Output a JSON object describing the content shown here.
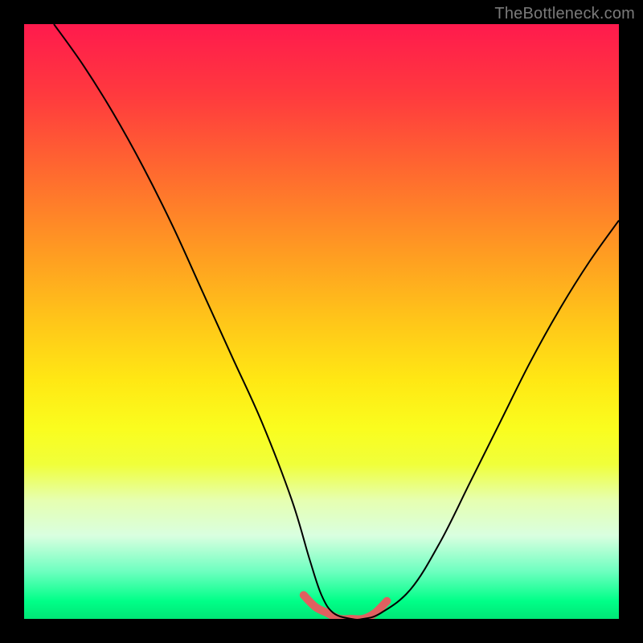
{
  "watermark": "TheBottleneck.com",
  "colors": {
    "background": "#000000",
    "curve": "#000000",
    "highlight": "#e06060"
  },
  "chart_data": {
    "type": "line",
    "title": "",
    "xlabel": "",
    "ylabel": "",
    "xlim": [
      0,
      100
    ],
    "ylim": [
      0,
      100
    ],
    "grid": false,
    "legend": false,
    "series": [
      {
        "name": "curve",
        "x": [
          5,
          10,
          15,
          20,
          25,
          30,
          35,
          40,
          45,
          48,
          50,
          52,
          55,
          57,
          60,
          65,
          70,
          75,
          80,
          85,
          90,
          95,
          100
        ],
        "y": [
          100,
          93,
          85,
          76,
          66,
          55,
          44,
          33,
          20,
          10,
          4,
          1,
          0,
          0,
          1,
          5,
          13,
          23,
          33,
          43,
          52,
          60,
          67
        ]
      },
      {
        "name": "highlight",
        "x": [
          47,
          49,
          51,
          53,
          55,
          57,
          59,
          61
        ],
        "y": [
          4,
          2,
          1,
          0,
          0,
          0,
          1,
          3
        ]
      }
    ]
  }
}
